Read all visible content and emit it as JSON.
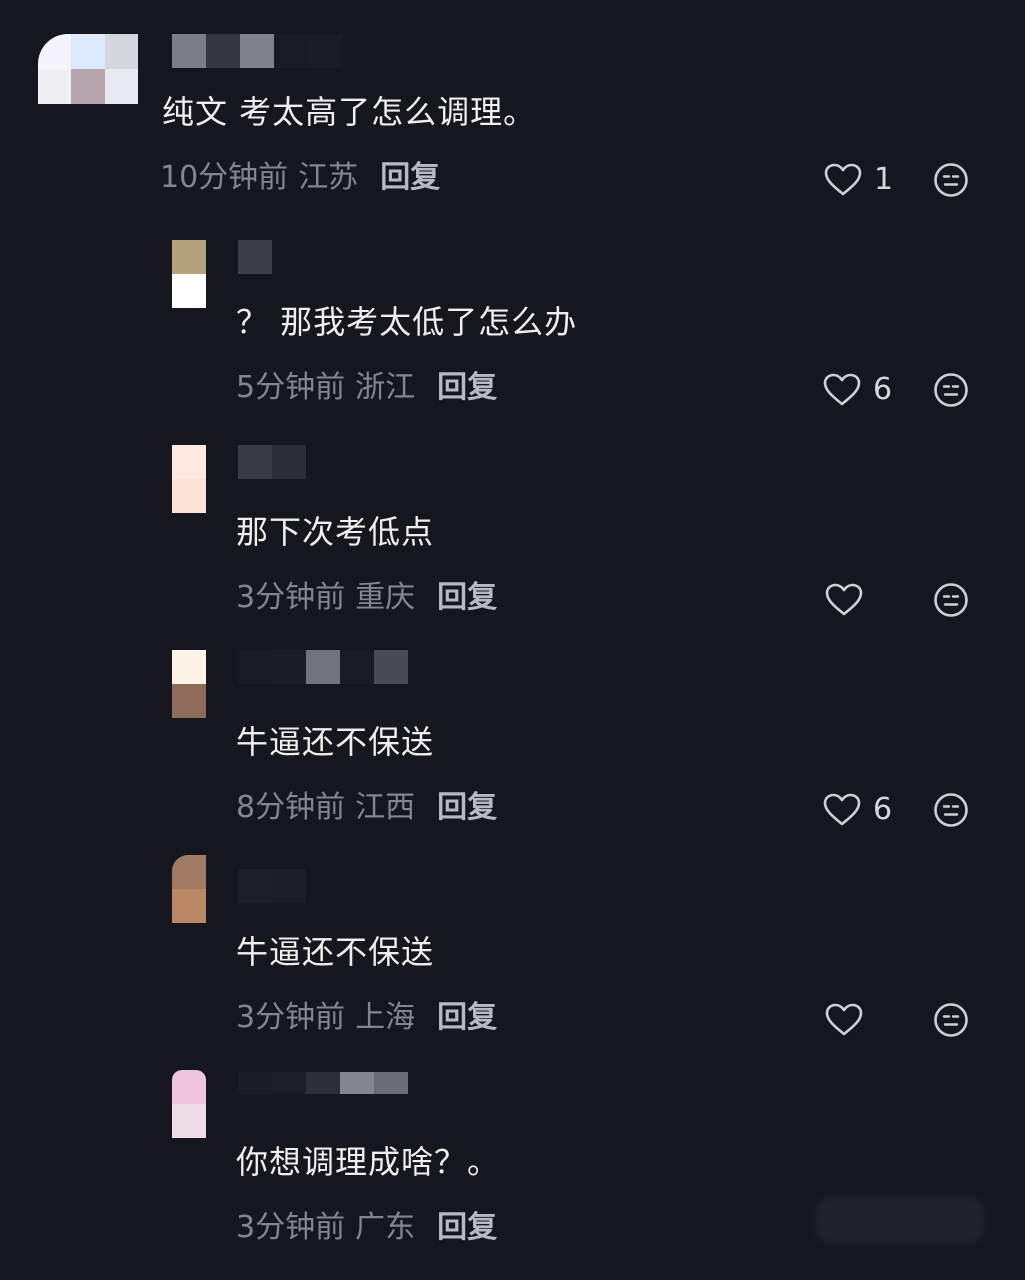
{
  "comments": [
    {
      "text": "纯文 考太高了怎么调理。",
      "time": "10分钟前",
      "location": "江苏",
      "reply_label": "回复",
      "likes": "1",
      "avatar_colors": [
        "#f2f5fb",
        "#dde9fc",
        "#d6d6de",
        "#f0f0f4",
        "#b5a7ad",
        "#e9e9f1"
      ],
      "name_colors": [
        "#7d7d87",
        "#34363e",
        "#80828b",
        "#1a1b22",
        "#1b1c23"
      ]
    },
    {
      "text": "？ 那我考太低了怎么办",
      "time": "5分钟前",
      "location": "浙江",
      "reply_label": "回复",
      "likes": "6",
      "avatar_colors": [
        "#b3a27b",
        "#ffffff"
      ],
      "name_colors": [
        "#3e4048"
      ]
    },
    {
      "text": "那下次考低点",
      "time": "3分钟前",
      "location": "重庆",
      "reply_label": "回复",
      "likes": "",
      "avatar_colors": [
        "#fde9df",
        "#fbe2d6"
      ],
      "name_colors": [
        "#3a3b42",
        "#2d2e35"
      ]
    },
    {
      "text": "牛逼还不保送",
      "time": "8分钟前",
      "location": "江西",
      "reply_label": "回复",
      "likes": "6",
      "avatar_colors": [
        "#fdf3e9",
        "#8e6a5b"
      ],
      "name_colors": [
        "#1a1b22",
        "#1c1d24",
        "#71737b",
        "#1a1b22",
        "#4a4b52"
      ]
    },
    {
      "text": "牛逼还不保送",
      "time": "3分钟前",
      "location": "上海",
      "reply_label": "回复",
      "likes": "",
      "avatar_colors": [
        "#a07a63",
        "#b98763"
      ],
      "name_colors": [
        "#1e1f26",
        "#1d1e25"
      ]
    },
    {
      "text": "你想调理成啥？。",
      "time": "3分钟前",
      "location": "广东",
      "reply_label": "回复",
      "likes": "",
      "avatar_colors": [
        "#f0c6dd",
        "#efdde8"
      ],
      "name_colors": [
        "#1c1d24",
        "#1e1f26",
        "#2e2f36",
        "#84868e",
        "#6b6d75"
      ]
    }
  ],
  "icons": {
    "like": "heart-outline-icon",
    "react": "emoji-face-icon"
  },
  "colors": {
    "background": "#16161e",
    "text": "#efefef",
    "meta": "#858591",
    "reply": "#b9b9c1",
    "icon": "#cfcfd6"
  }
}
